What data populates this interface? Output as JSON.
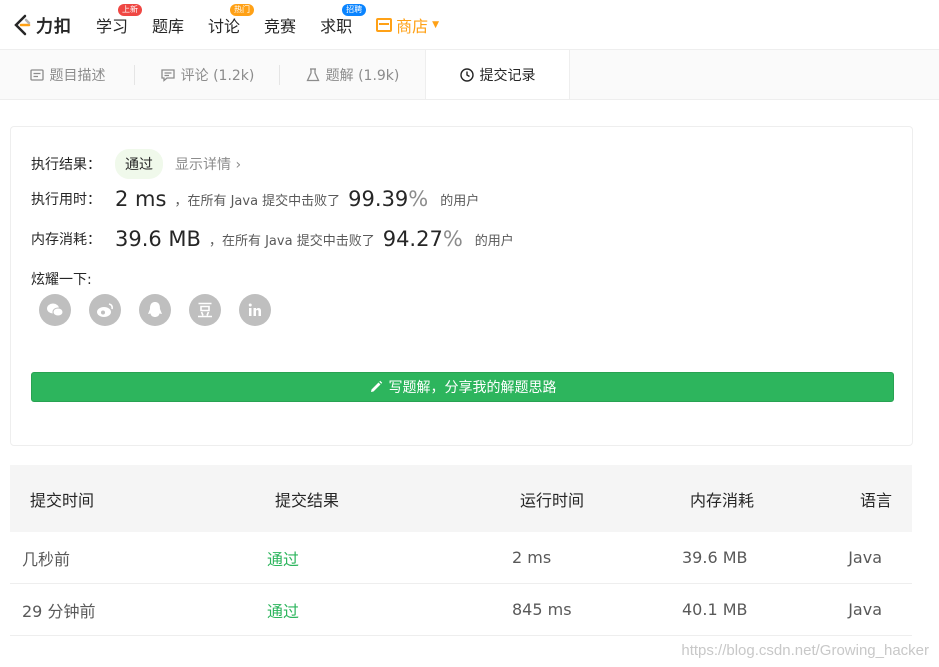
{
  "nav": {
    "logo_text": "力扣",
    "items": [
      {
        "label": "学习",
        "badge": "上新",
        "badge_color": "#ef4743"
      },
      {
        "label": "题库",
        "badge": "",
        "badge_color": ""
      },
      {
        "label": "讨论",
        "badge": "热门",
        "badge_color": "#ffa116"
      },
      {
        "label": "竞赛",
        "badge": "",
        "badge_color": ""
      },
      {
        "label": "求职",
        "badge": "招聘",
        "badge_color": "#0a84ff"
      }
    ],
    "shop_label": "商店"
  },
  "tabs": [
    {
      "label": "题目描述",
      "icon": "description-icon"
    },
    {
      "label": "评论 (1.2k)",
      "icon": "comment-icon"
    },
    {
      "label": "题解 (1.9k)",
      "icon": "flask-icon"
    },
    {
      "label": "提交记录",
      "icon": "clock-icon"
    }
  ],
  "result": {
    "status_label": "执行结果：",
    "status_value": "通过",
    "detail_link": "显示详情 ›",
    "runtime_label": "执行用时：",
    "runtime_value": "2 ms",
    "runtime_mid": "，在所有 Java 提交中击败了",
    "runtime_pct": "99.39",
    "pct_unit": "%",
    "users_suffix": "的用户",
    "memory_label": "内存消耗：",
    "memory_value": "39.6 MB",
    "memory_mid": "，在所有 Java 提交中击败了",
    "memory_pct": "94.27",
    "share_label": "炫耀一下:",
    "share_icons": [
      "wechat-icon",
      "weibo-icon",
      "qq-icon",
      "douban-icon",
      "linkedin-icon"
    ],
    "write_button": "写题解，分享我的解题思路"
  },
  "table": {
    "headers": [
      "提交时间",
      "提交结果",
      "运行时间",
      "内存消耗",
      "语言"
    ],
    "rows": [
      [
        "几秒前",
        "通过",
        "2 ms",
        "39.6 MB",
        "Java"
      ],
      [
        "29 分钟前",
        "通过",
        "845 ms",
        "40.1 MB",
        "Java"
      ]
    ]
  },
  "watermark": "https://blog.csdn.net/Growing_hacker",
  "colors": {
    "accent": "#ffa116",
    "success": "#2db55d"
  }
}
